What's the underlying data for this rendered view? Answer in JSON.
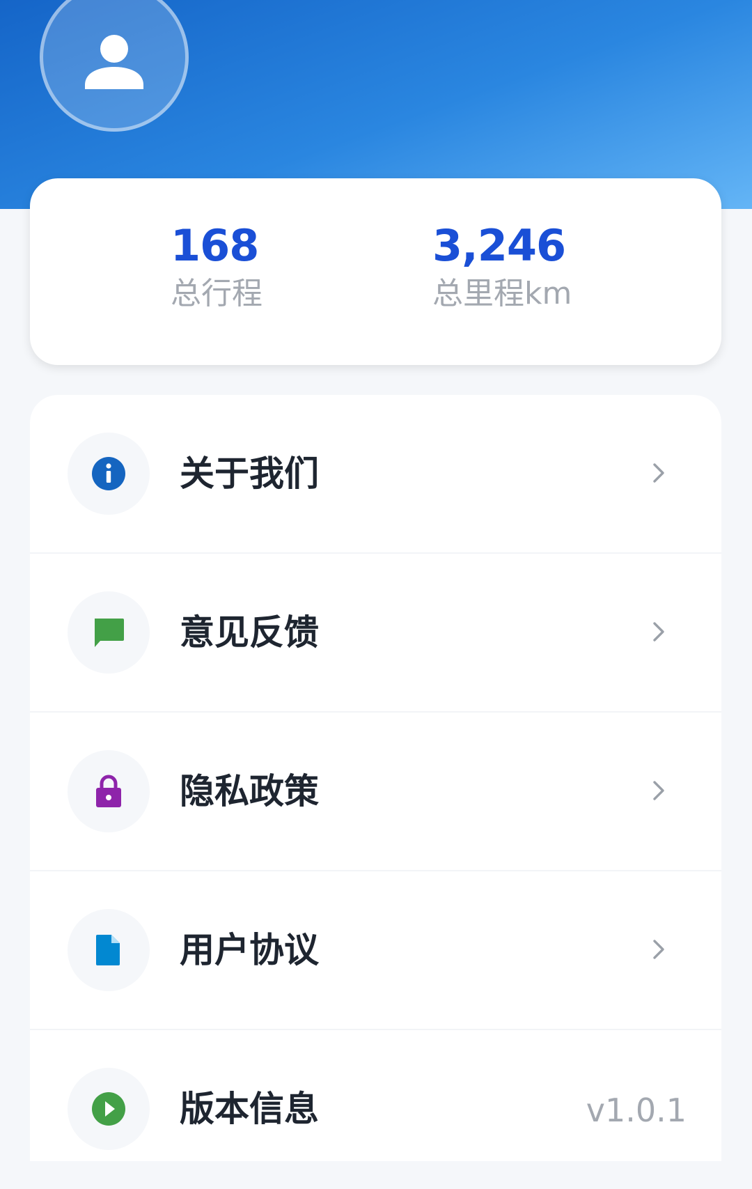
{
  "profile": {
    "avatar_icon": "person-icon"
  },
  "stats": [
    {
      "value": "168",
      "label": "总行程"
    },
    {
      "value": "3,246",
      "label": "总里程km"
    }
  ],
  "menu": [
    {
      "label": "关于我们",
      "icon": "info-icon",
      "color": "#1565c0"
    },
    {
      "label": "意见反馈",
      "icon": "feedback-icon",
      "color": "#43a047"
    },
    {
      "label": "隐私政策",
      "icon": "lock-icon",
      "color": "#8e24aa"
    },
    {
      "label": "用户协议",
      "icon": "document-icon",
      "color": "#0288d1"
    },
    {
      "label": "版本信息",
      "icon": "play-icon",
      "color": "#43a047",
      "value": "v1.0.1"
    }
  ],
  "colors": {
    "accent": "#1a4fd6",
    "header_gradient_start": "#1565c8",
    "header_gradient_end": "#64b5f6"
  }
}
